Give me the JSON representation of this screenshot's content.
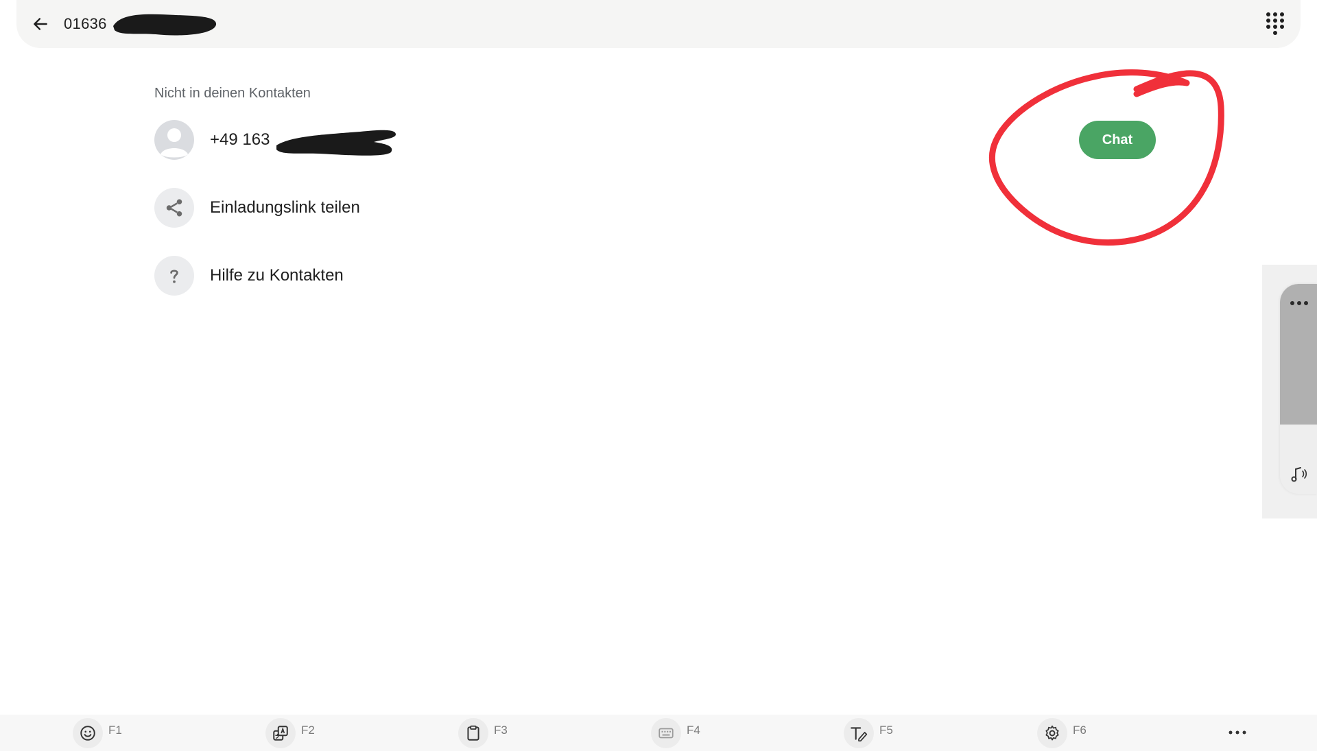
{
  "header": {
    "number": "01636",
    "back_icon": "arrow-left-icon",
    "dialpad_icon": "dialpad-icon"
  },
  "contact": {
    "section_label": "Nicht in deinen Kontakten",
    "phone": "+49 163",
    "avatar_icon": "person-avatar-icon",
    "chat_label": "Chat",
    "chat_color": "#4aa564"
  },
  "actions": [
    {
      "label": "Einladungslink teilen",
      "icon": "share-icon"
    },
    {
      "label": "Hilfe zu Kontakten",
      "icon": "help-icon"
    }
  ],
  "side_panel": {
    "more_icon": "more-horizontal-icon",
    "music_icon": "music-note-icon",
    "level": 0.67
  },
  "bottom_bar": {
    "keys": [
      {
        "label": "F1",
        "icon": "emoji-icon"
      },
      {
        "label": "F2",
        "icon": "translate-icon"
      },
      {
        "label": "F3",
        "icon": "clipboard-icon"
      },
      {
        "label": "F4",
        "icon": "keyboard-icon"
      },
      {
        "label": "F5",
        "icon": "text-style-icon"
      },
      {
        "label": "F6",
        "icon": "settings-icon"
      }
    ],
    "more_icon": "more-horizontal-icon"
  },
  "annotation": {
    "color": "#f0303a"
  }
}
